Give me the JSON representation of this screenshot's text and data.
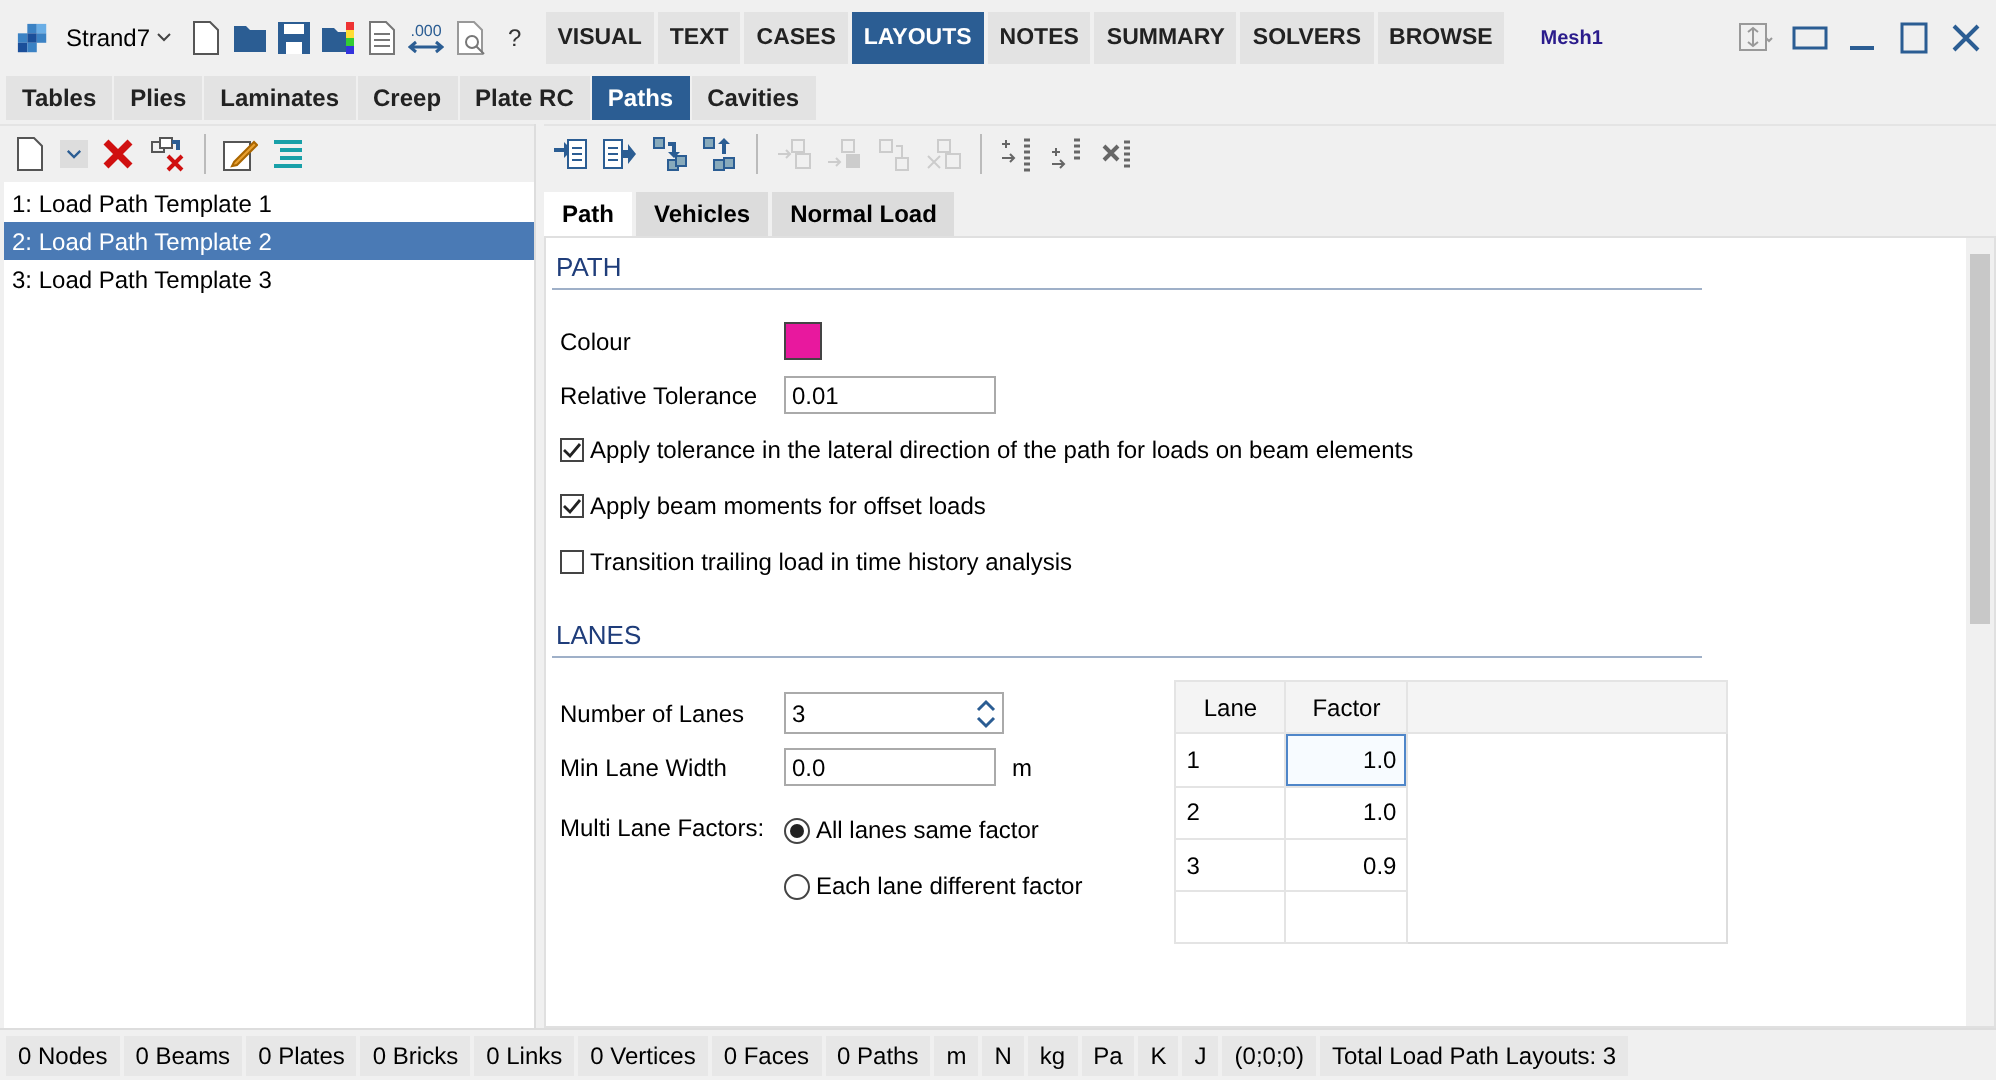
{
  "app_menu": {
    "label": "Strand7"
  },
  "quick_access": {
    "format_label": ".000",
    "help": "?"
  },
  "main_tabs": [
    {
      "label": "VISUAL",
      "selected": false
    },
    {
      "label": "TEXT",
      "selected": false
    },
    {
      "label": "CASES",
      "selected": false
    },
    {
      "label": "LAYOUTS",
      "selected": true
    },
    {
      "label": "NOTES",
      "selected": false
    },
    {
      "label": "SUMMARY",
      "selected": false
    },
    {
      "label": "SOLVERS",
      "selected": false
    },
    {
      "label": "BROWSE",
      "selected": false
    }
  ],
  "model_name": "Mesh1",
  "sub_tabs": [
    {
      "label": "Tables",
      "selected": false
    },
    {
      "label": "Plies",
      "selected": false
    },
    {
      "label": "Laminates",
      "selected": false
    },
    {
      "label": "Creep",
      "selected": false
    },
    {
      "label": "Plate RC",
      "selected": false
    },
    {
      "label": "Paths",
      "selected": true
    },
    {
      "label": "Cavities",
      "selected": false
    }
  ],
  "path_toolbar": [
    {
      "disabled": false
    },
    {
      "disabled": false
    },
    {
      "disabled": false
    },
    {
      "disabled": false
    },
    {
      "disabled": true
    },
    {
      "disabled": true
    },
    {
      "disabled": true
    },
    {
      "disabled": true
    },
    {
      "disabled": false
    },
    {
      "disabled": false
    },
    {
      "disabled": false
    }
  ],
  "templates": [
    {
      "label": "1: Load Path Template 1",
      "selected": false
    },
    {
      "label": "2: Load Path Template 2",
      "selected": true
    },
    {
      "label": "3: Load Path Template 3",
      "selected": false
    }
  ],
  "panel_tabs": [
    {
      "label": "Path",
      "selected": true
    },
    {
      "label": "Vehicles",
      "selected": false
    },
    {
      "label": "Normal Load",
      "selected": false
    }
  ],
  "path_section": {
    "title": "PATH",
    "colour_field": {
      "label": "Colour",
      "color": "#e8189e"
    },
    "tolerance_label": "Relative Tolerance",
    "tolerance_value": "0.01",
    "options": [
      {
        "label": "Apply tolerance in the lateral direction of the path for loads on beam elements",
        "checked": true
      },
      {
        "label": "Apply beam moments for offset loads",
        "checked": true
      },
      {
        "label": "Transition trailing load in time history analysis",
        "checked": false
      }
    ]
  },
  "lanes_section": {
    "title": "LANES",
    "count_label": "Number of Lanes",
    "count_value": "3",
    "min_width_label": "Min Lane Width",
    "min_width_value": "0.0",
    "min_width_unit": "m",
    "factors_label": "Multi Lane Factors:",
    "factor_modes": [
      {
        "label": "All lanes same factor",
        "selected": true
      },
      {
        "label": "Each lane different factor",
        "selected": false
      }
    ],
    "table": {
      "columns": [
        "Lane",
        "Factor"
      ],
      "rows": [
        {
          "lane": "1",
          "factor": "1.0",
          "selected": true
        },
        {
          "lane": "2",
          "factor": "1.0",
          "selected": false
        },
        {
          "lane": "3",
          "factor": "0.9",
          "selected": false
        }
      ]
    }
  },
  "status_bar": [
    "0 Nodes",
    "0 Beams",
    "0 Plates",
    "0 Bricks",
    "0 Links",
    "0 Vertices",
    "0 Faces",
    "0 Paths",
    "m",
    "N",
    "kg",
    "Pa",
    "K",
    "J",
    "(0;0;0)",
    "Total Load Path Layouts: 3"
  ]
}
